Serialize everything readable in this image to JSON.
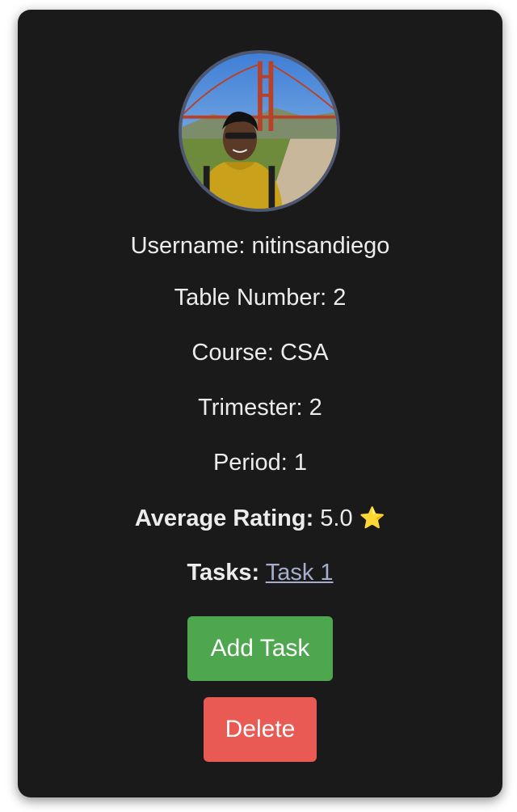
{
  "profile": {
    "avatar_alt": "profile photo",
    "username_label": "Username:",
    "username": "nitinsandiego",
    "table_label": "Table Number:",
    "table_number": "2",
    "course_label": "Course:",
    "course": "CSA",
    "trimester_label": "Trimester:",
    "trimester": "2",
    "period_label": "Period:",
    "period": "1",
    "rating_label": "Average Rating:",
    "rating": "5.0",
    "rating_icon": "⭐",
    "tasks_label": "Tasks:",
    "tasks": [
      "Task 1"
    ]
  },
  "actions": {
    "add_label": "Add Task",
    "delete_label": "Delete"
  },
  "colors": {
    "card_bg": "#1a1a1a",
    "text": "#ececec",
    "link": "#a6aecb",
    "add_button": "#4ea74f",
    "delete_button": "#ea5a55",
    "avatar_border": "#4f5670"
  }
}
